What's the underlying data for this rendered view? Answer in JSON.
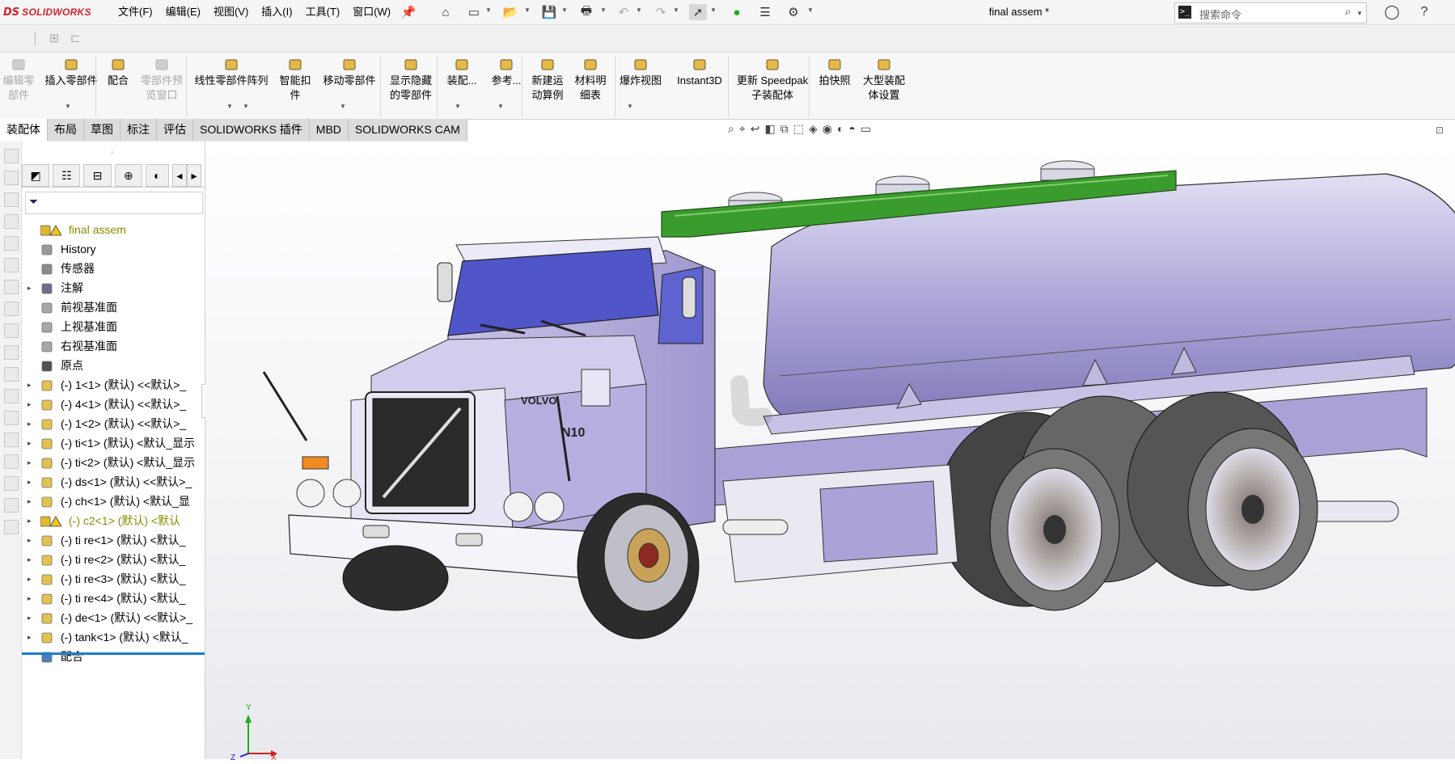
{
  "app": {
    "brand_ds": "DS",
    "brand_name": "SOLIDWORKS",
    "doc_title": "final assem *"
  },
  "menus": [
    "文件(F)",
    "编辑(E)",
    "视图(V)",
    "插入(I)",
    "工具(T)",
    "窗口(W)"
  ],
  "search": {
    "placeholder": "搜索命令"
  },
  "command_manager": {
    "buttons": [
      {
        "label_1": "编辑零",
        "label_2": "部件",
        "icon": "edit-component-icon",
        "enabled": false
      },
      {
        "label_1": "插入零部件",
        "label_2": "",
        "icon": "insert-component-icon",
        "enabled": true
      },
      {
        "label_1": "配合",
        "label_2": "",
        "icon": "mate-icon",
        "enabled": true
      },
      {
        "label_1": "零部件预",
        "label_2": "览窗口",
        "icon": "component-preview-icon",
        "enabled": false
      },
      {
        "label_1": "线性零部件阵列",
        "label_2": "",
        "icon": "linear-pattern-icon",
        "enabled": true
      },
      {
        "label_1": "智能扣",
        "label_2": "件",
        "icon": "smart-fastener-icon",
        "enabled": true
      },
      {
        "label_1": "移动零部件",
        "label_2": "",
        "icon": "move-component-icon",
        "enabled": true
      },
      {
        "label_1": "显示隐藏",
        "label_2": "的零部件",
        "icon": "show-hidden-icon",
        "enabled": true
      },
      {
        "label_1": "装配...",
        "label_2": "",
        "icon": "assembly-features-icon",
        "enabled": true
      },
      {
        "label_1": "参考...",
        "label_2": "",
        "icon": "reference-geometry-icon",
        "enabled": true
      },
      {
        "label_1": "新建运",
        "label_2": "动算例",
        "icon": "new-motion-study-icon",
        "enabled": true
      },
      {
        "label_1": "材料明",
        "label_2": "细表",
        "icon": "bill-of-materials-icon",
        "enabled": true
      },
      {
        "label_1": "爆炸视图",
        "label_2": "",
        "icon": "exploded-view-icon",
        "enabled": true
      },
      {
        "label_1": "Instant3D",
        "label_2": "",
        "icon": "instant3d-icon",
        "enabled": true
      },
      {
        "label_1": "更新 Speedpak",
        "label_2": "子装配体",
        "icon": "speedpak-icon",
        "enabled": true
      },
      {
        "label_1": "拍快照",
        "label_2": "",
        "icon": "snapshot-icon",
        "enabled": true
      },
      {
        "label_1": "大型装配",
        "label_2": "体设置",
        "icon": "large-assembly-icon",
        "enabled": true
      }
    ]
  },
  "tabs": [
    "装配体",
    "布局",
    "草图",
    "标注",
    "评估",
    "SOLIDWORKS 插件",
    "MBD",
    "SOLIDWORKS CAM"
  ],
  "active_tab": "装配体",
  "tree": [
    {
      "label": "final assem",
      "icon": "assembly-icon",
      "expander": "",
      "style": "olive-root"
    },
    {
      "label": "History",
      "icon": "history-icon",
      "expander": "",
      "style": ""
    },
    {
      "label": "传感器",
      "icon": "sensor-icon",
      "expander": "",
      "style": ""
    },
    {
      "label": "注解",
      "icon": "annotation-icon",
      "expander": "▸",
      "style": ""
    },
    {
      "label": "前视基准面",
      "icon": "plane-icon",
      "expander": "",
      "style": ""
    },
    {
      "label": "上视基准面",
      "icon": "plane-icon",
      "expander": "",
      "style": ""
    },
    {
      "label": "右视基准面",
      "icon": "plane-icon",
      "expander": "",
      "style": ""
    },
    {
      "label": "原点",
      "icon": "origin-icon",
      "expander": "",
      "style": ""
    },
    {
      "label": "(-) 1<1> (默认) <<默认>_",
      "icon": "part-icon",
      "expander": "▸",
      "style": ""
    },
    {
      "label": "(-) 4<1> (默认) <<默认>_",
      "icon": "part-icon",
      "expander": "▸",
      "style": ""
    },
    {
      "label": "(-) 1<2> (默认) <<默认>_",
      "icon": "part-icon",
      "expander": "▸",
      "style": ""
    },
    {
      "label": "(-) ti<1> (默认) <默认_显示",
      "icon": "part-icon",
      "expander": "▸",
      "style": ""
    },
    {
      "label": "(-) ti<2> (默认) <默认_显示",
      "icon": "part-icon",
      "expander": "▸",
      "style": ""
    },
    {
      "label": "(-) ds<1> (默认) <<默认>_",
      "icon": "part-icon",
      "expander": "▸",
      "style": ""
    },
    {
      "label": "(-) ch<1> (默认) <默认_显",
      "icon": "part-icon",
      "expander": "▸",
      "style": ""
    },
    {
      "label": "(-) c2<1> (默认) <默认",
      "icon": "warning-part-icon",
      "expander": "▸",
      "style": "olive"
    },
    {
      "label": "(-) ti re<1> (默认) <默认_",
      "icon": "part-icon",
      "expander": "▸",
      "style": ""
    },
    {
      "label": "(-) ti re<2> (默认) <默认_",
      "icon": "part-icon",
      "expander": "▸",
      "style": ""
    },
    {
      "label": "(-) ti re<3> (默认) <默认_",
      "icon": "part-icon",
      "expander": "▸",
      "style": ""
    },
    {
      "label": "(-) ti re<4> (默认) <默认_",
      "icon": "part-icon",
      "expander": "▸",
      "style": ""
    },
    {
      "label": "(-) de<1> (默认) <<默认>_",
      "icon": "part-icon",
      "expander": "▸",
      "style": ""
    },
    {
      "label": "(-) tank<1> (默认) <默认_",
      "icon": "part-icon",
      "expander": "▸",
      "style": ""
    },
    {
      "label": "配合",
      "icon": "mates-icon",
      "expander": "",
      "style": ""
    }
  ],
  "model": {
    "badge_text": "VOLVO",
    "model_text": "N10"
  },
  "triad": {
    "x": "X",
    "y": "Y",
    "z": "Z"
  },
  "colors": {
    "accent": "#1e7ec8",
    "tank": "#a9a3d6",
    "windshield": "#5055c8",
    "rack": "#3b9c2e",
    "cab": "#b7b0de"
  }
}
